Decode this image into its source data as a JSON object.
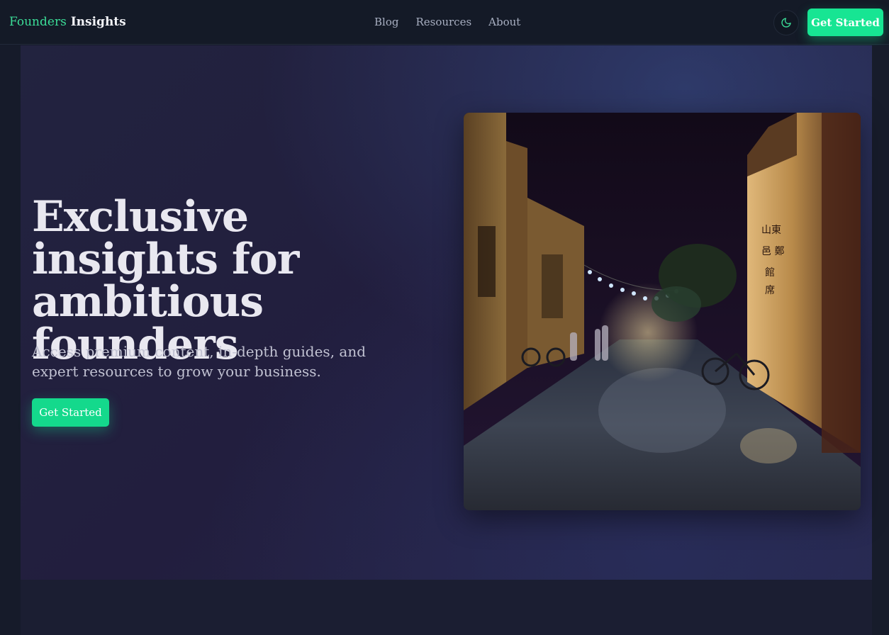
{
  "header": {
    "brand_part1": "Founders",
    "brand_part2": "Insights",
    "nav": [
      {
        "label": "Blog"
      },
      {
        "label": "Resources"
      },
      {
        "label": "About"
      }
    ],
    "theme_toggle_icon": "moon-icon",
    "cta_label": "Get Started"
  },
  "hero": {
    "title": "Exclusive insights for ambitious founders",
    "subtitle": "Access premium content, in-depth guides, and expert resources to grow your business.",
    "cta_label": "Get Started",
    "image_subject": "night street photo"
  },
  "colors": {
    "accent": "#17e593",
    "background": "#151a2a",
    "hero_bg": "#22233f",
    "heading": "#e9e8f0"
  }
}
